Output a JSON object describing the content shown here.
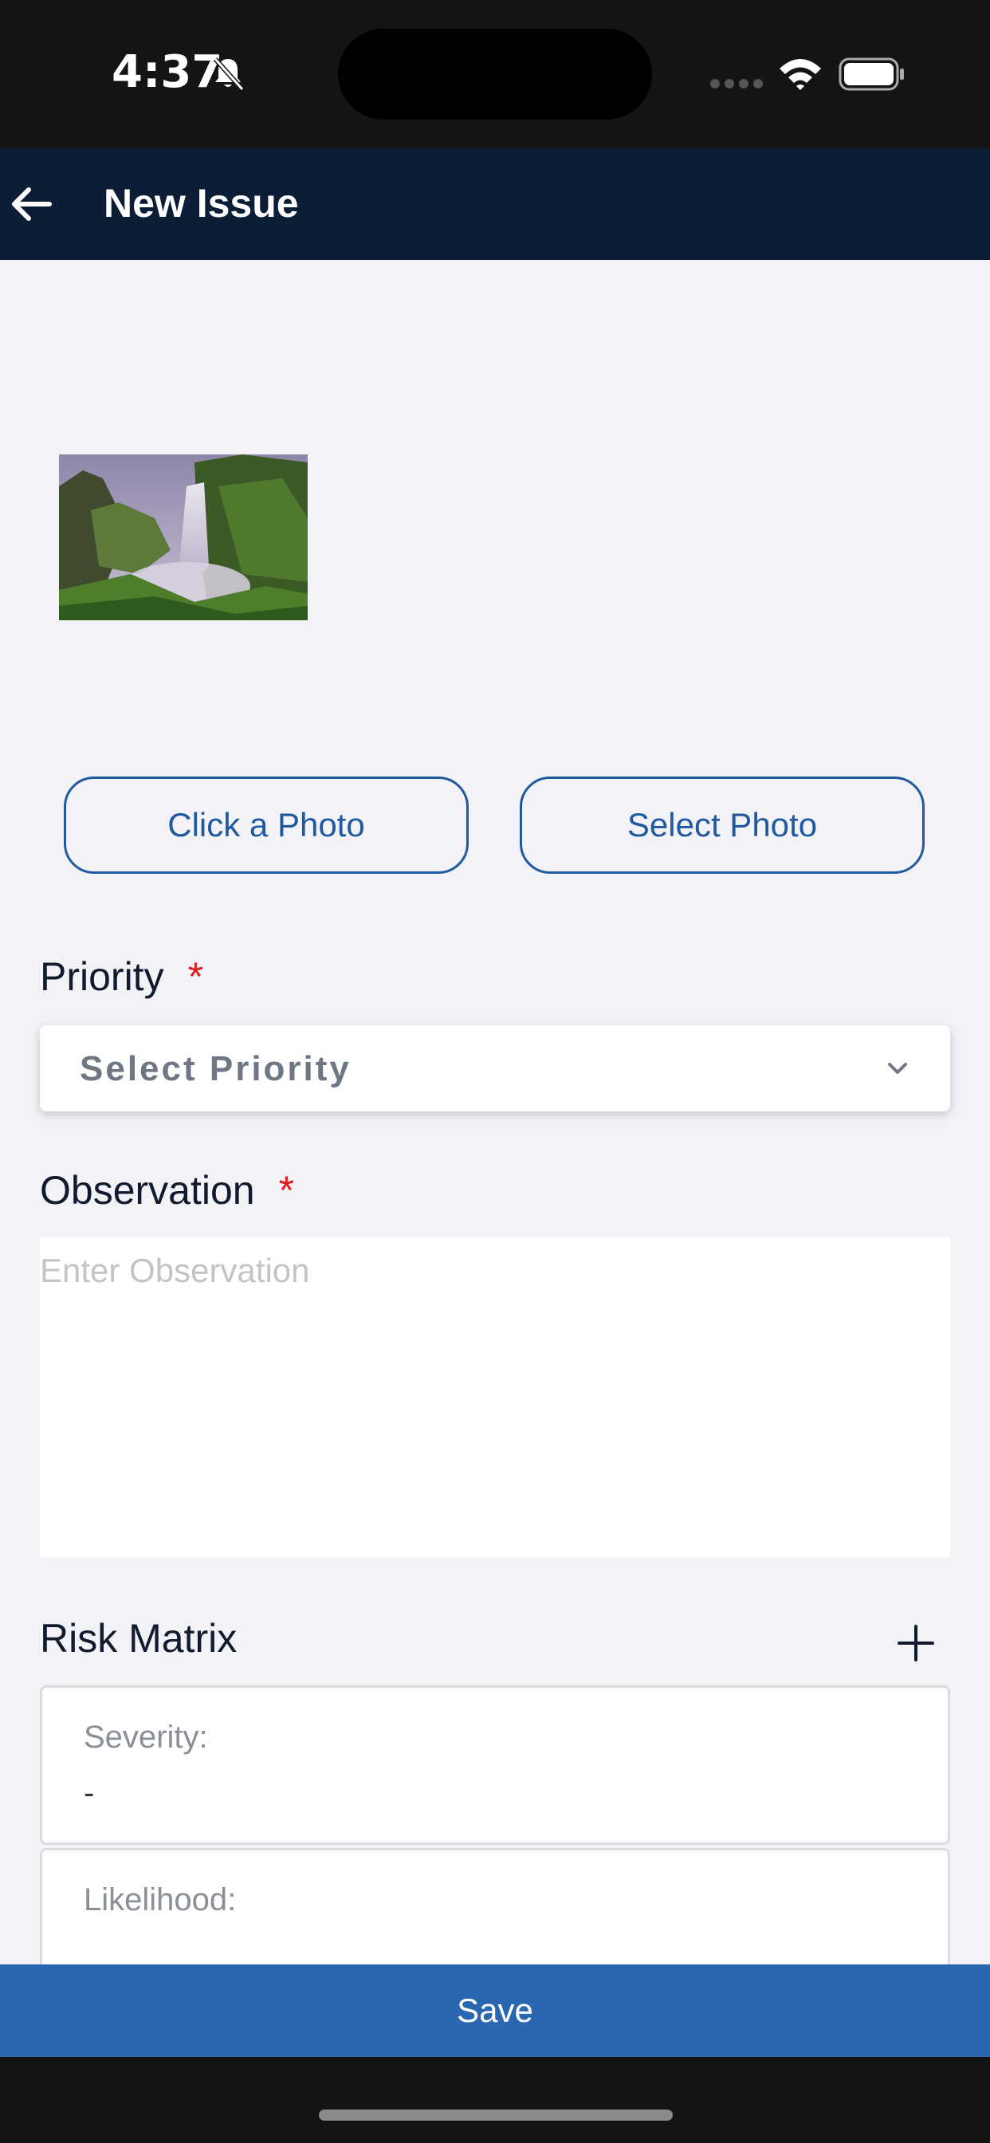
{
  "status": {
    "time": "4:37"
  },
  "nav": {
    "title": "New Issue"
  },
  "photo_buttons": {
    "click": "Click a Photo",
    "select": "Select Photo"
  },
  "priority": {
    "label": "Priority",
    "required_mark": "*",
    "placeholder": "Select Priority"
  },
  "observation": {
    "label": "Observation",
    "required_mark": "*",
    "placeholder": "Enter Observation"
  },
  "risk_matrix": {
    "label": "Risk Matrix",
    "severity": {
      "label": "Severity:",
      "value": "-"
    },
    "likelihood": {
      "label": "Likelihood:"
    }
  },
  "save": {
    "label": "Save"
  },
  "colors": {
    "nav_bg": "#0c1d36",
    "accent": "#1f5aa0",
    "save_bg": "#2967b1",
    "required": "#e01a1a"
  }
}
